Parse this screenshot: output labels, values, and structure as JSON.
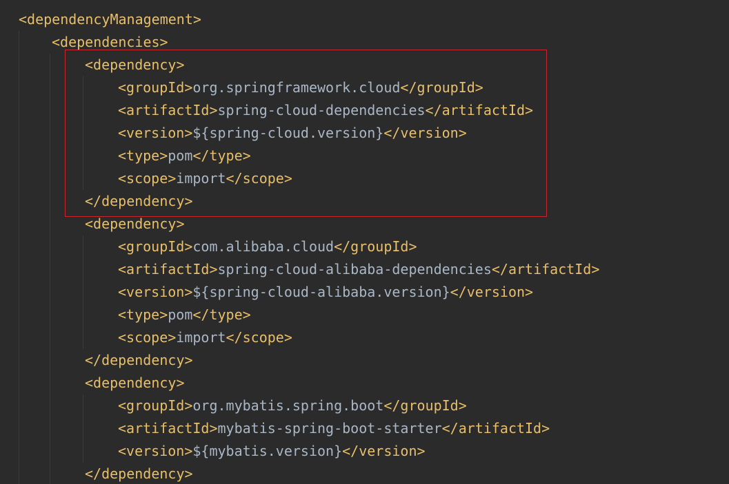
{
  "editor": {
    "lines": [
      {
        "indent": 0,
        "open": "<dependencyManagement>",
        "text": "",
        "close": ""
      },
      {
        "indent": 1,
        "open": "<dependencies>",
        "text": "",
        "close": ""
      },
      {
        "indent": 2,
        "open": "<dependency>",
        "text": "",
        "close": ""
      },
      {
        "indent": 3,
        "open": "<groupId>",
        "text": "org.springframework.cloud",
        "close": "</groupId>"
      },
      {
        "indent": 3,
        "open": "<artifactId>",
        "text": "spring-cloud-dependencies",
        "close": "</artifactId>"
      },
      {
        "indent": 3,
        "open": "<version>",
        "text": "${spring-cloud.version}",
        "close": "</version>"
      },
      {
        "indent": 3,
        "open": "<type>",
        "text": "pom",
        "close": "</type>"
      },
      {
        "indent": 3,
        "open": "<scope>",
        "text": "import",
        "close": "</scope>"
      },
      {
        "indent": 2,
        "open": "</dependency>",
        "text": "",
        "close": ""
      },
      {
        "indent": 2,
        "open": "<dependency>",
        "text": "",
        "close": ""
      },
      {
        "indent": 3,
        "open": "<groupId>",
        "text": "com.alibaba.cloud",
        "close": "</groupId>"
      },
      {
        "indent": 3,
        "open": "<artifactId>",
        "text": "spring-cloud-alibaba-dependencies",
        "close": "</artifactId>"
      },
      {
        "indent": 3,
        "open": "<version>",
        "text": "${spring-cloud-alibaba.version}",
        "close": "</version>"
      },
      {
        "indent": 3,
        "open": "<type>",
        "text": "pom",
        "close": "</type>"
      },
      {
        "indent": 3,
        "open": "<scope>",
        "text": "import",
        "close": "</scope>"
      },
      {
        "indent": 2,
        "open": "</dependency>",
        "text": "",
        "close": ""
      },
      {
        "indent": 2,
        "open": "<dependency>",
        "text": "",
        "close": ""
      },
      {
        "indent": 3,
        "open": "<groupId>",
        "text": "org.mybatis.spring.boot",
        "close": "</groupId>"
      },
      {
        "indent": 3,
        "open": "<artifactId>",
        "text": "mybatis-spring-boot-starter",
        "close": "</artifactId>"
      },
      {
        "indent": 3,
        "open": "<version>",
        "text": "${mybatis.version}",
        "close": "</version>"
      },
      {
        "indent": 2,
        "open": "</dependency>",
        "text": "",
        "close": ""
      }
    ]
  },
  "colors": {
    "background": "#2b2b2b",
    "tag": "#e8bf6a",
    "text": "#a9b7c6",
    "highlight_border": "#c8262c",
    "indent_guide": "#3b3b3b"
  }
}
